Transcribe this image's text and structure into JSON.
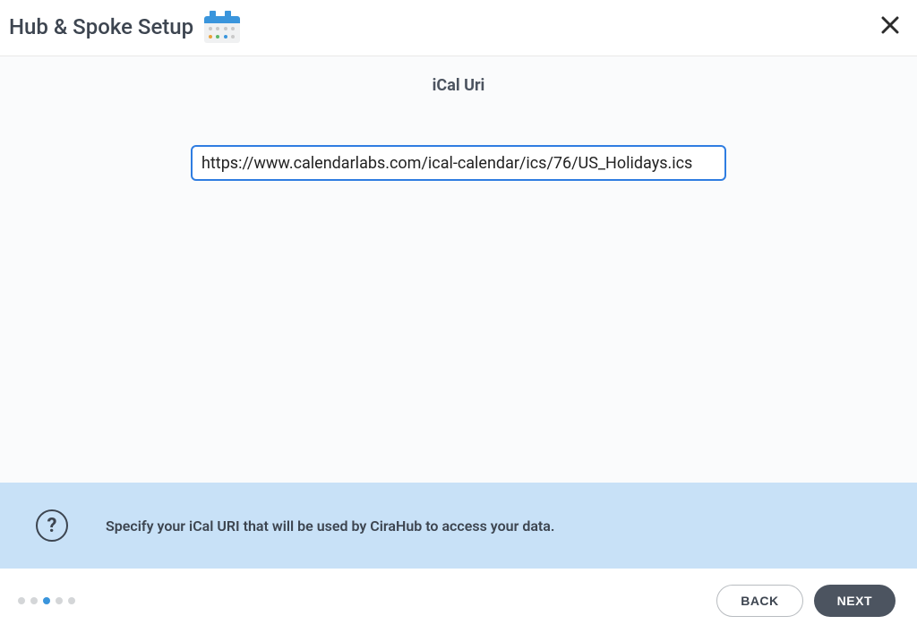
{
  "header": {
    "title": "Hub & Spoke Setup"
  },
  "main": {
    "section_title": "iCal Uri",
    "uri_value": "https://www.calendarlabs.com/ical-calendar/ics/76/US_Holidays.ics"
  },
  "info": {
    "help_symbol": "?",
    "text": "Specify your iCal URI that will be used by CiraHub to access your data."
  },
  "footer": {
    "back_label": "BACK",
    "next_label": "NEXT",
    "progress": {
      "total": 5,
      "current_index": 2
    }
  }
}
